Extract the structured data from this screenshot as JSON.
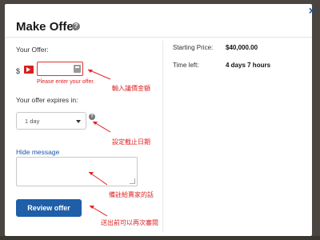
{
  "modal": {
    "title": "Make Offer",
    "help_icon": "question-circle-icon",
    "close_label": "×",
    "close_icon": "close-icon"
  },
  "offer": {
    "label": "Your Offer:",
    "currency": "$",
    "value": "",
    "error": "Please enter your offer.",
    "calculator_icon": "calculator-icon",
    "flag_icon": "arrow-flag-icon"
  },
  "expires": {
    "label": "Your offer expires in:",
    "selected": "1 day",
    "info_icon": "question-circle-icon"
  },
  "message": {
    "toggle_label": "Hide message",
    "value": ""
  },
  "actions": {
    "review_label": "Review offer"
  },
  "summary": {
    "starting_price_label": "Starting Price:",
    "starting_price_value": "$40,000.00",
    "time_left_label": "Time left:",
    "time_left_value": "4 days 7 hours"
  },
  "annotations": {
    "enter_amount": "輸入議價金額",
    "set_expiry": "設定截止日期",
    "note_to_seller": "備註給賣家的話",
    "review_before_send": "送出前可以再次審閱"
  },
  "colors": {
    "accent": "#1f5ea8",
    "error": "#dd2222",
    "backdrop": "#4a4540"
  }
}
